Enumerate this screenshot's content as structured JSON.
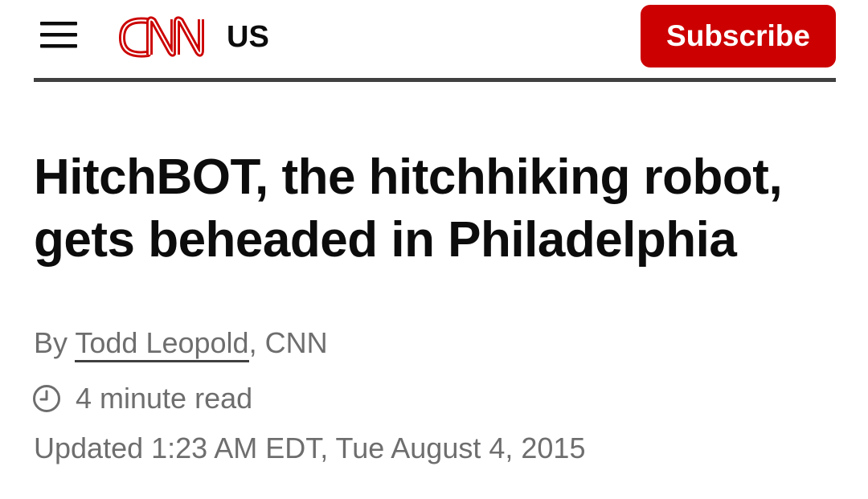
{
  "header": {
    "logo_text": "CNN",
    "edition": "US",
    "subscribe_label": "Subscribe"
  },
  "article": {
    "headline": "HitchBOT, the hitchhiking robot, gets beheaded in Philadelphia",
    "byline": {
      "prefix": "By ",
      "author": "Todd Leopold",
      "suffix": ", CNN"
    },
    "read_time": "4 minute read",
    "updated": "Updated 1:23 AM EDT, Tue August 4, 2015"
  },
  "colors": {
    "brand_red": "#cc0000",
    "text_dark": "#0c0c0c",
    "text_muted": "#6e6e6e",
    "rule": "#404040"
  },
  "icons": {
    "menu": "hamburger-menu-icon",
    "clock": "clock-icon"
  }
}
